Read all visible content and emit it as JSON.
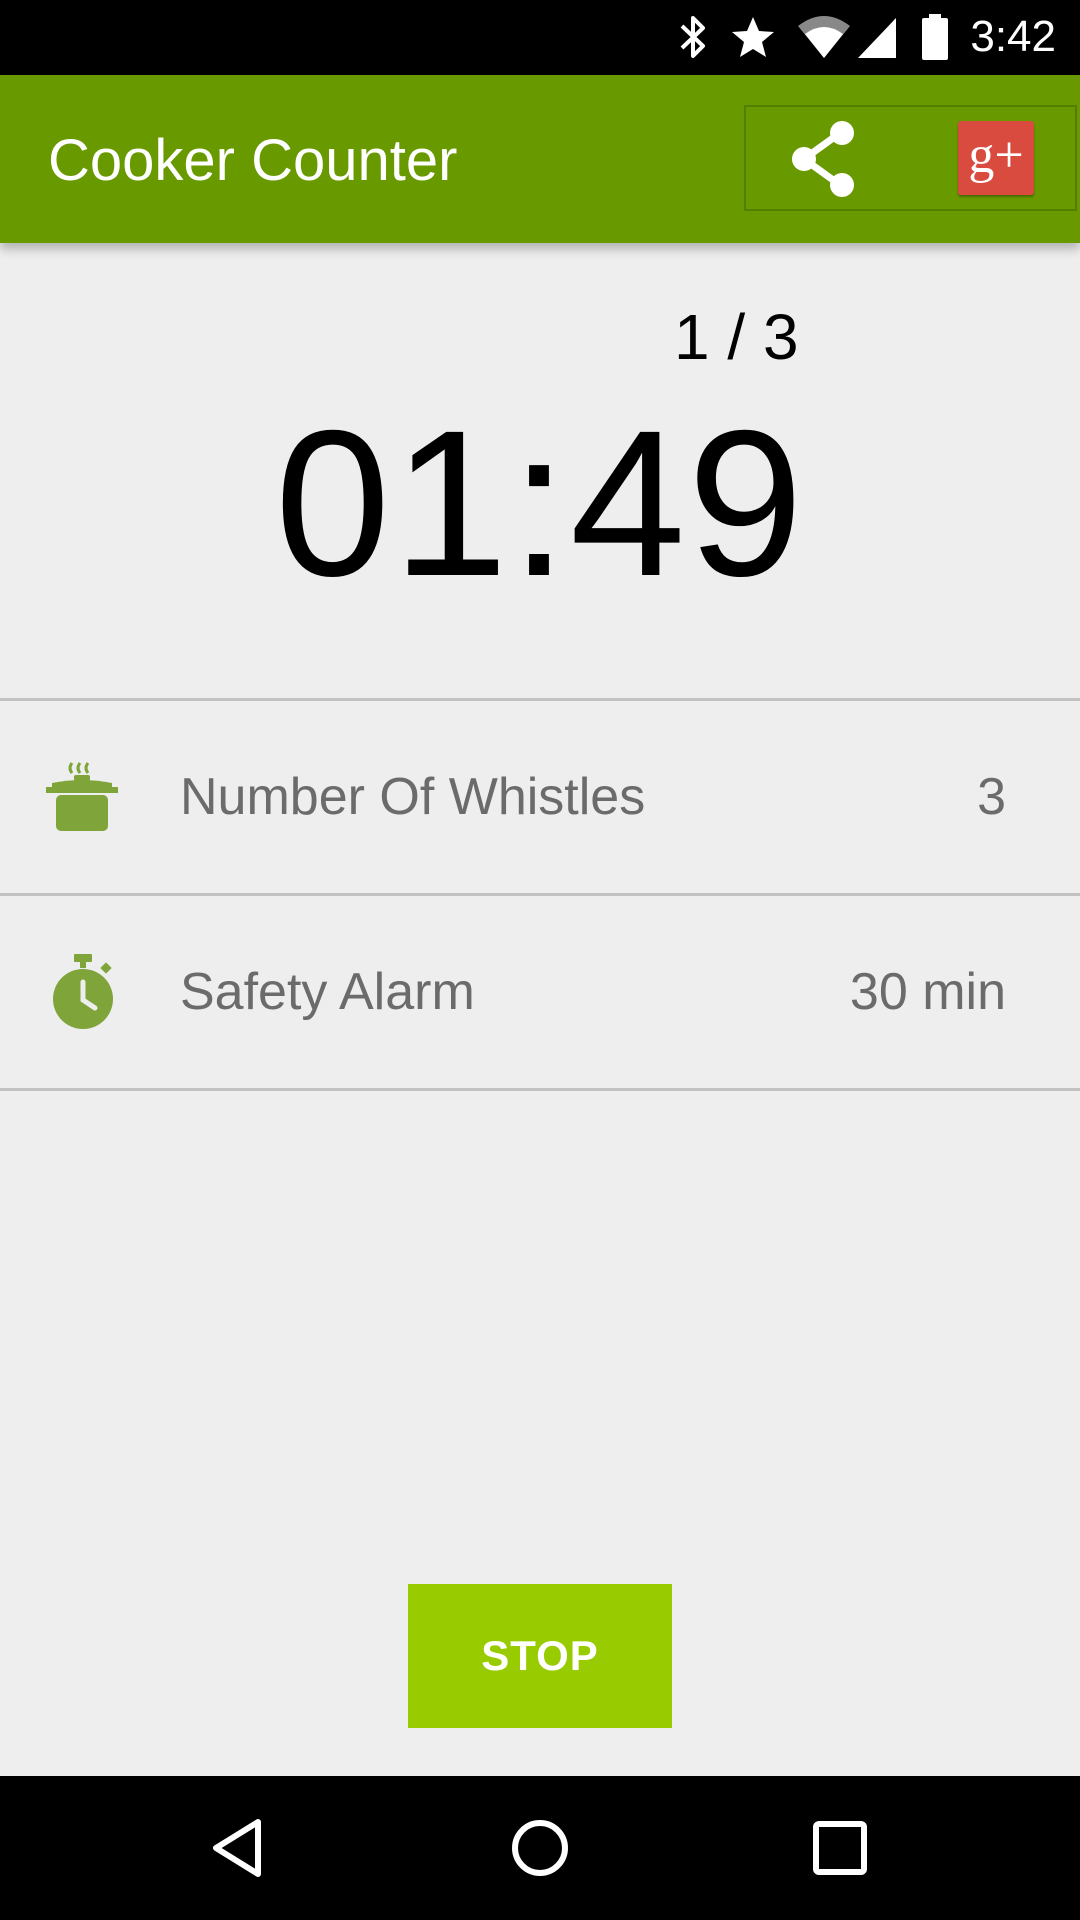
{
  "status_bar": {
    "time": "3:42",
    "icons": [
      "bluetooth-icon",
      "star-icon",
      "wifi-icon",
      "signal-icon",
      "battery-icon"
    ]
  },
  "app_bar": {
    "title": "Cooker Counter",
    "share_icon": "share-icon",
    "gplus_label": "g+"
  },
  "counter": {
    "whistles_progress": "1 / 3",
    "timer": "01:49"
  },
  "settings": [
    {
      "icon": "cooker-icon",
      "label": "Number Of Whistles",
      "value": "3"
    },
    {
      "icon": "stopwatch-icon",
      "label": "Safety Alarm",
      "value": "30 min"
    }
  ],
  "stop_button": {
    "label": "STOP"
  },
  "colors": {
    "app_bar": "#689a00",
    "accent": "#99cc00",
    "icon_green": "#7ea43a",
    "gplus": "#d84b3e"
  },
  "nav_bar": {
    "icons": [
      "back-icon",
      "home-icon",
      "recents-icon"
    ]
  }
}
